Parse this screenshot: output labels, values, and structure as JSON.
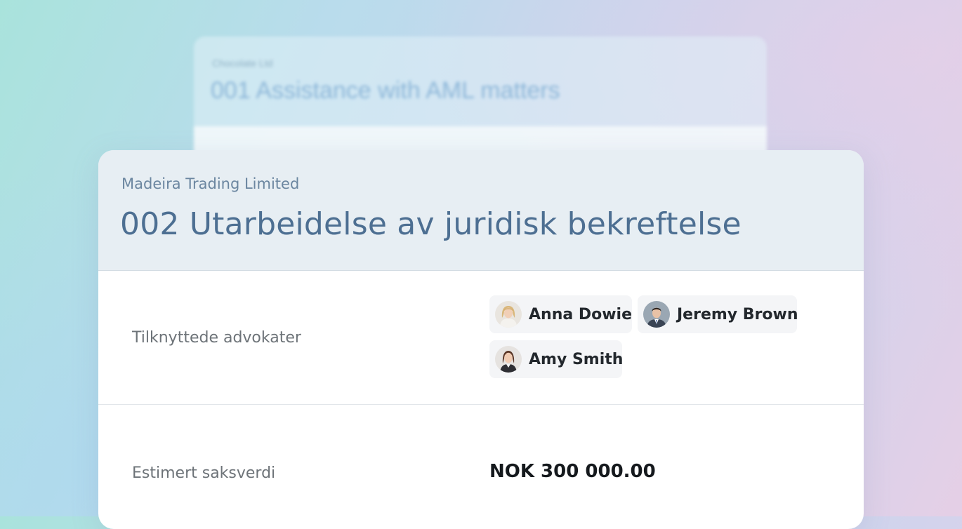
{
  "background_card": {
    "client": "Chocolate Ltd",
    "title": "001 Assistance with AML matters"
  },
  "matter": {
    "client": "Madeira Trading Limited",
    "title": "002 Utarbeidelse av juridisk bekreftelse"
  },
  "lawyers": {
    "label": "Tilknyttede advokater",
    "items": [
      {
        "name": "Anna Dowie",
        "avatar": "avatar-woman-blonde"
      },
      {
        "name": "Jeremy Brown",
        "avatar": "avatar-man-suit"
      },
      {
        "name": "Amy Smith",
        "avatar": "avatar-woman-brunette"
      }
    ]
  },
  "estimated_value": {
    "label": "Estimert saksverdi",
    "value": "NOK 300 000.00"
  },
  "colors": {
    "title": "#4d6f92",
    "client": "#6b86a0",
    "chip_bg": "#f4f5f7",
    "label": "#6d7378"
  }
}
